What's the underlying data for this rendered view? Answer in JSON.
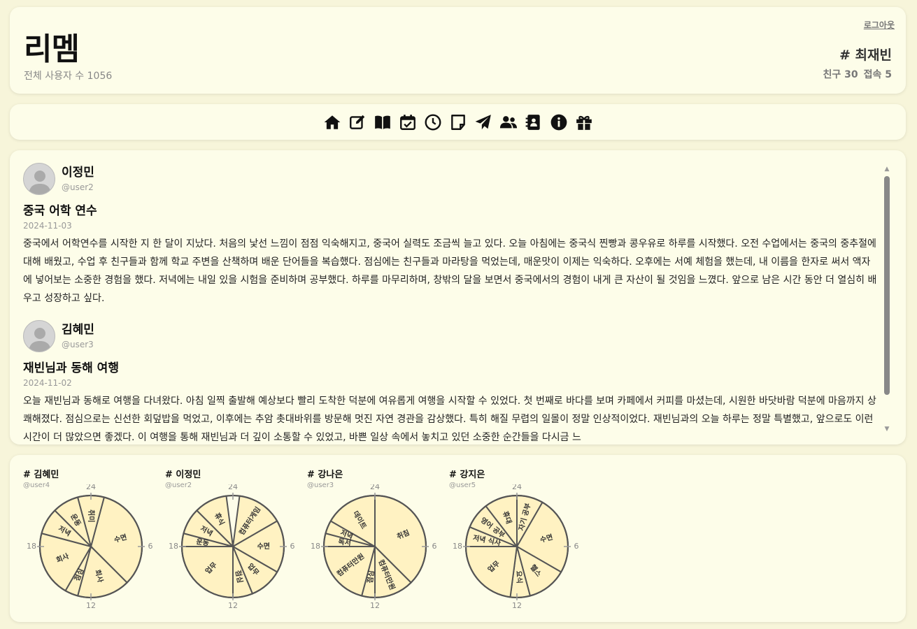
{
  "app": {
    "title": "리멤",
    "user_count": "전체 사용자 수 1056"
  },
  "account": {
    "logout": "로그아웃",
    "name": "# 최재빈",
    "friends": "친구 30",
    "visits": "접속 5"
  },
  "nav": {
    "icons": [
      "home-icon",
      "edit-icon",
      "book-icon",
      "calendar-check-icon",
      "clock-icon",
      "note-icon",
      "send-icon",
      "users-icon",
      "address-book-icon",
      "info-icon",
      "gift-icon"
    ]
  },
  "posts": [
    {
      "name": "이정민",
      "handle": "@user2",
      "title": "중국 어학 연수",
      "date": "2024-11-03",
      "body": "중국에서 어학연수를 시작한 지 한 달이 지났다. 처음의 낯선 느낌이 점점 익숙해지고, 중국어 실력도 조금씩 늘고 있다. 오늘 아침에는 중국식 찐빵과 콩우유로 하루를 시작했다. 오전 수업에서는 중국의 중추절에 대해 배웠고, 수업 후 친구들과 함께 학교 주변을 산책하며 배운 단어들을 복습했다. 점심에는 친구들과 마라탕을 먹었는데, 매운맛이 이제는 익숙하다. 오후에는 서예 체험을 했는데, 내 이름을 한자로 써서 액자에 넣어보는 소중한 경험을 했다. 저녁에는 내일 있을 시험을 준비하며 공부했다. 하루를 마무리하며, 창밖의 달을 보면서 중국에서의 경험이 내게 큰 자산이 될 것임을 느꼈다. 앞으로 남은 시간 동안 더 열심히 배우고 성장하고 싶다."
    },
    {
      "name": "김혜민",
      "handle": "@user3",
      "title": "재빈님과 동해 여행",
      "date": "2024-11-02",
      "body": "오늘 재빈님과 동해로 여행을 다녀왔다. 아침 일찍 출발해 예상보다 빨리 도착한 덕분에 여유롭게 여행을 시작할 수 있었다. 첫 번째로 바다를 보며 카페에서 커피를 마셨는데, 시원한 바닷바람 덕분에 마음까지 상쾌해졌다. 점심으로는 신선한 회덮밥을 먹었고, 이후에는 추암 촛대바위를 방문해 멋진 자연 경관을 감상했다. 특히 해질 무렵의 일몰이 정말 인상적이었다. 재빈님과의 오늘 하루는 정말 특별했고, 앞으로도 이런 시간이 더 많았으면 좋겠다. 이 여행을 통해 재빈님과 더 깊이 소통할 수 있었고, 바쁜 일상 속에서 놓치고 있던 소중한 순간들을 다시금 느"
    }
  ],
  "clock_labels": {
    "top": "24",
    "right": "6",
    "bottom": "12",
    "left": "18"
  },
  "chart_data": [
    {
      "type": "pie",
      "title": "# 김혜민",
      "subtitle": "@user4",
      "axis": "24-hour clock",
      "segments": [
        {
          "label": "수면",
          "start": 1,
          "end": 9
        },
        {
          "label": "회사",
          "start": 9,
          "end": 13
        },
        {
          "label": "점심",
          "start": 13,
          "end": 14
        },
        {
          "label": "회사",
          "start": 14,
          "end": 19
        },
        {
          "label": "저녁",
          "start": 19,
          "end": 21
        },
        {
          "label": "운동",
          "start": 21,
          "end": 23
        },
        {
          "label": "취미",
          "start": 23,
          "end": 25
        }
      ]
    },
    {
      "type": "pie",
      "title": "# 이정민",
      "subtitle": "@user2",
      "axis": "24-hour clock",
      "segments": [
        {
          "label": "컴퓨터게임",
          "start": 0.5,
          "end": 4
        },
        {
          "label": "수면",
          "start": 4,
          "end": 8
        },
        {
          "label": "업무",
          "start": 8,
          "end": 10.5
        },
        {
          "label": "점심",
          "start": 10.5,
          "end": 12
        },
        {
          "label": "업무",
          "start": 12,
          "end": 18
        },
        {
          "label": "운동",
          "start": 18,
          "end": 19
        },
        {
          "label": "저녁",
          "start": 19,
          "end": 21
        },
        {
          "label": "휴식",
          "start": 21,
          "end": 23.5
        }
      ]
    },
    {
      "type": "pie",
      "title": "# 강나은",
      "subtitle": "@user3",
      "axis": "24-hour clock",
      "segments": [
        {
          "label": "취침",
          "start": 0,
          "end": 9
        },
        {
          "label": "컴퓨터만원",
          "start": 9,
          "end": 12
        },
        {
          "label": "점심",
          "start": 12,
          "end": 13
        },
        {
          "label": "컴퓨터만원",
          "start": 13,
          "end": 18
        },
        {
          "label": "독서",
          "start": 18,
          "end": 19
        },
        {
          "label": "저녁",
          "start": 19,
          "end": 20
        },
        {
          "label": "데이트",
          "start": 20,
          "end": 24
        }
      ]
    },
    {
      "type": "pie",
      "title": "# 강지은",
      "subtitle": "@user5",
      "axis": "24-hour clock",
      "segments": [
        {
          "label": "자기 공부",
          "start": 0,
          "end": 2
        },
        {
          "label": "수면",
          "start": 2,
          "end": 8
        },
        {
          "label": "헬스",
          "start": 8,
          "end": 11
        },
        {
          "label": "요식",
          "start": 11,
          "end": 12.5
        },
        {
          "label": "업무",
          "start": 12.5,
          "end": 18
        },
        {
          "label": "저녁 식사",
          "start": 18,
          "end": 19.5
        },
        {
          "label": "영어 공부",
          "start": 19.5,
          "end": 21.5
        },
        {
          "label": "휴대",
          "start": 21.5,
          "end": 24
        }
      ]
    }
  ],
  "colors": {
    "pie_fill": "#fff2c2",
    "pie_stroke": "#555555",
    "background": "#f7f5da",
    "card": "#fdfde9"
  }
}
